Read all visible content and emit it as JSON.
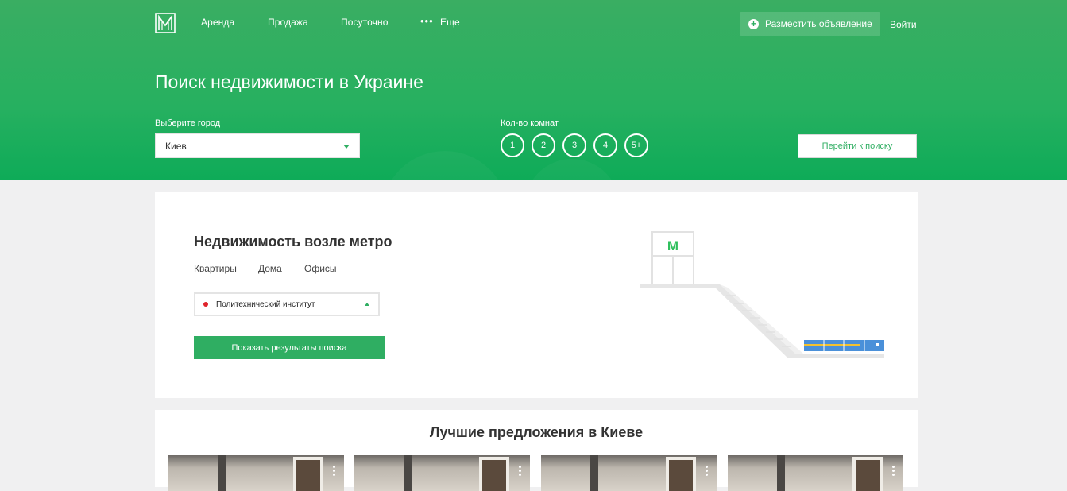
{
  "header": {
    "logo_icon": "logo-m-icon",
    "nav": [
      {
        "label": "Аренда"
      },
      {
        "label": "Продажа"
      },
      {
        "label": "Посуточно"
      },
      {
        "label": "Еще"
      }
    ],
    "post_ad_label": "Разместить объявление",
    "login_label": "Войти"
  },
  "hero": {
    "title": "Поиск недвижимости в Украине",
    "city_label": "Выберите город",
    "city_value": "Киев",
    "rooms_label": "Кол-во комнат",
    "rooms": [
      "1",
      "2",
      "3",
      "4",
      "5+"
    ],
    "search_button": "Перейти к поиску"
  },
  "metro": {
    "title": "Недвижимость возле метро",
    "tabs": [
      "Квартиры",
      "Дома",
      "Офисы"
    ],
    "station_value": "Политехнический институт",
    "station_dot_color": "#e0232b",
    "show_button": "Показать результаты поиска",
    "sign_letter": "M"
  },
  "offers": {
    "title": "Лучшие предложения в Киеве",
    "count_visible": 4
  },
  "colors": {
    "brand_green": "#2fae62",
    "metro_red": "#e0232b",
    "train_blue": "#4a90d9"
  }
}
